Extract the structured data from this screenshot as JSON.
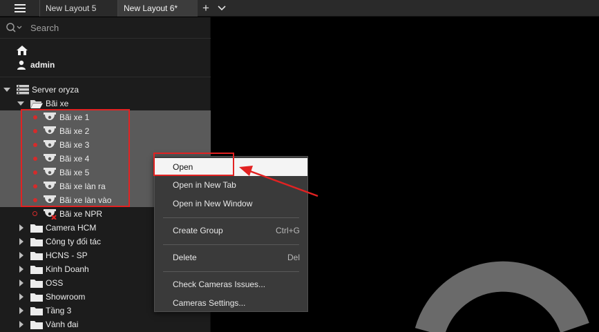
{
  "tabs": [
    {
      "label": "New Layout 5"
    },
    {
      "label": "New Layout 6*"
    }
  ],
  "tab_add_label": "+",
  "search": {
    "placeholder": "Search"
  },
  "user": {
    "name": "admin"
  },
  "tree": {
    "server": "Server oryza",
    "group": "Bãi xe",
    "cameras": [
      {
        "label": "Bãi xe 1",
        "status": "online"
      },
      {
        "label": "Bãi xe 2",
        "status": "online"
      },
      {
        "label": "Bãi xe 3",
        "status": "online"
      },
      {
        "label": "Bãi xe 4",
        "status": "online"
      },
      {
        "label": "Bãi xe 5",
        "status": "online"
      },
      {
        "label": "Bãi xe làn ra",
        "status": "online"
      },
      {
        "label": "Bãi xe làn vào",
        "status": "online"
      },
      {
        "label": "Bãi xe NPR",
        "status": "offline"
      }
    ],
    "folders": [
      "Camera HCM",
      "Công ty đối tác",
      "HCNS - SP",
      "Kinh Doanh",
      "OSS",
      "Showroom",
      "Tầng 3",
      "Vành đai"
    ]
  },
  "context_menu": {
    "items": [
      {
        "label": "Open",
        "shortcut": ""
      },
      {
        "label": "Open in New Tab",
        "shortcut": ""
      },
      {
        "label": "Open in New Window",
        "shortcut": ""
      },
      {
        "label": "Create Group",
        "shortcut": "Ctrl+G"
      },
      {
        "label": "Delete",
        "shortcut": "Del"
      },
      {
        "label": "Check Cameras Issues...",
        "shortcut": ""
      },
      {
        "label": "Cameras Settings...",
        "shortcut": ""
      }
    ]
  },
  "colors": {
    "highlight_box": "#e22222",
    "selection_bg": "#5a5a5a",
    "status_dot": "#d52b2b",
    "menu_bg": "#3a3a3a"
  }
}
